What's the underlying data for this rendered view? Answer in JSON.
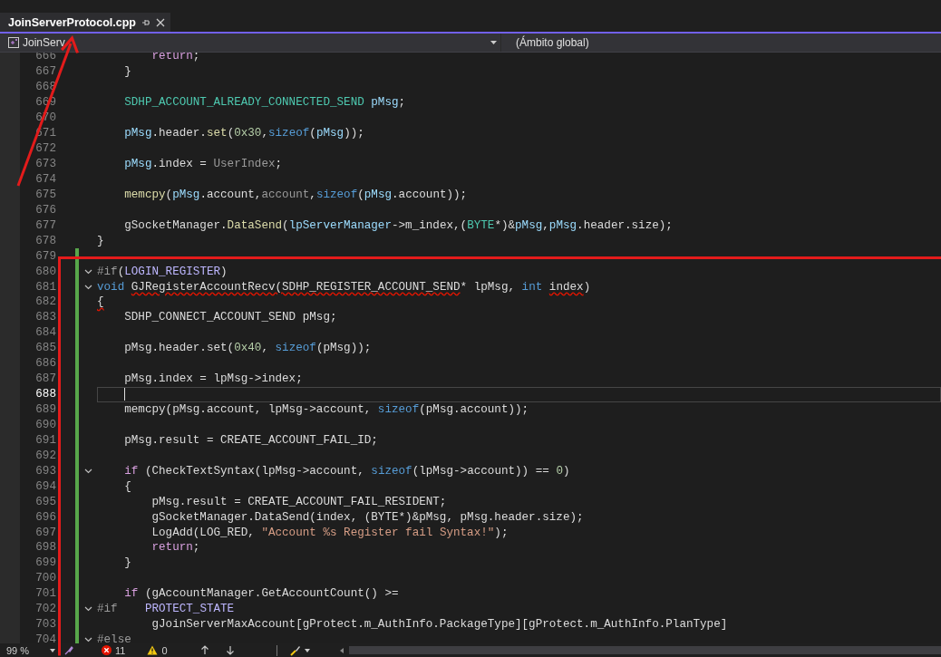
{
  "tabs": [
    {
      "label": "JoinServerProtocol.cpp",
      "selected": true
    }
  ],
  "navigation": {
    "project": "JoinServ",
    "scope": "(Ámbito global)"
  },
  "editor": {
    "lines": [
      {
        "number": "666",
        "changed": false,
        "collapsible": false,
        "current": false,
        "tokens": [
          {
            "kind": "ctl",
            "text": "        return"
          },
          {
            "kind": "plain",
            "text": ";"
          }
        ]
      },
      {
        "number": "667",
        "changed": false,
        "collapsible": false,
        "current": false,
        "tokens": [
          {
            "kind": "plain",
            "text": "    }"
          }
        ]
      },
      {
        "number": "668",
        "changed": false,
        "collapsible": false,
        "current": false
      },
      {
        "number": "669",
        "changed": false,
        "collapsible": false,
        "current": false,
        "tokens": [
          {
            "kind": "type",
            "text": "    SDHP_ACCOUNT_ALREADY_CONNECTED_SEND"
          },
          {
            "kind": "var",
            "text": " pMsg"
          },
          {
            "kind": "plain",
            "text": ";"
          }
        ]
      },
      {
        "number": "670",
        "changed": false,
        "collapsible": false,
        "current": false
      },
      {
        "number": "671",
        "changed": false,
        "collapsible": false,
        "current": false,
        "tokens": [
          {
            "kind": "var",
            "text": "    pMsg"
          },
          {
            "kind": "plain",
            "text": ".header."
          },
          {
            "kind": "fn",
            "text": "set"
          },
          {
            "kind": "plain",
            "text": "("
          },
          {
            "kind": "num",
            "text": "0x30"
          },
          {
            "kind": "plain",
            "text": ","
          },
          {
            "kind": "kw",
            "text": "sizeof"
          },
          {
            "kind": "plain",
            "text": "("
          },
          {
            "kind": "var",
            "text": "pMsg"
          },
          {
            "kind": "plain",
            "text": "));"
          }
        ]
      },
      {
        "number": "672",
        "changed": false,
        "collapsible": false,
        "current": false
      },
      {
        "number": "673",
        "changed": false,
        "collapsible": false,
        "current": false,
        "tokens": [
          {
            "kind": "var",
            "text": "    pMsg"
          },
          {
            "kind": "plain",
            "text": ".index = "
          },
          {
            "kind": "param",
            "text": "UserIndex"
          },
          {
            "kind": "plain",
            "text": ";"
          }
        ]
      },
      {
        "number": "674",
        "changed": false,
        "collapsible": false,
        "current": false
      },
      {
        "number": "675",
        "changed": false,
        "collapsible": false,
        "current": false,
        "tokens": [
          {
            "kind": "fn",
            "text": "    memcpy"
          },
          {
            "kind": "plain",
            "text": "("
          },
          {
            "kind": "var",
            "text": "pMsg"
          },
          {
            "kind": "plain",
            "text": ".account,"
          },
          {
            "kind": "param",
            "text": "account"
          },
          {
            "kind": "plain",
            "text": ","
          },
          {
            "kind": "kw",
            "text": "sizeof"
          },
          {
            "kind": "plain",
            "text": "("
          },
          {
            "kind": "var",
            "text": "pMsg"
          },
          {
            "kind": "plain",
            "text": ".account));"
          }
        ]
      },
      {
        "number": "676",
        "changed": false,
        "collapsible": false,
        "current": false
      },
      {
        "number": "677",
        "changed": false,
        "collapsible": false,
        "current": false,
        "tokens": [
          {
            "kind": "plain",
            "text": "    gSocketManager."
          },
          {
            "kind": "fn",
            "text": "DataSend"
          },
          {
            "kind": "plain",
            "text": "("
          },
          {
            "kind": "var",
            "text": "lpServerManager"
          },
          {
            "kind": "plain",
            "text": "->m_index,("
          },
          {
            "kind": "type",
            "text": "BYTE"
          },
          {
            "kind": "plain",
            "text": "*)&"
          },
          {
            "kind": "var",
            "text": "pMsg"
          },
          {
            "kind": "plain",
            "text": ","
          },
          {
            "kind": "var",
            "text": "pMsg"
          },
          {
            "kind": "plain",
            "text": ".header.size);"
          }
        ]
      },
      {
        "number": "678",
        "changed": false,
        "collapsible": false,
        "current": false,
        "tokens": [
          {
            "kind": "plain",
            "text": "}"
          }
        ]
      },
      {
        "number": "679",
        "changed": true,
        "collapsible": false,
        "current": false
      },
      {
        "number": "680",
        "changed": true,
        "collapsible": true,
        "current": false,
        "tokens": [
          {
            "kind": "pre",
            "text": "#if"
          },
          {
            "kind": "plain",
            "text": "("
          },
          {
            "kind": "macro",
            "text": "LOGIN_REGISTER"
          },
          {
            "kind": "plain",
            "text": ")"
          }
        ]
      },
      {
        "number": "681",
        "changed": true,
        "collapsible": true,
        "current": false,
        "tokens": [
          {
            "kind": "kw",
            "text": "void "
          },
          {
            "kind": "error",
            "text": "GJRegisterAccountRecv(SDHP_REGISTER_ACCOUNT_SEND"
          },
          {
            "kind": "plain",
            "text": "* lpMsg, "
          },
          {
            "kind": "kw",
            "text": "int "
          },
          {
            "kind": "error",
            "text": "index"
          },
          {
            "kind": "plain",
            "text": ")"
          }
        ]
      },
      {
        "number": "682",
        "changed": true,
        "collapsible": false,
        "current": false,
        "tokens": [
          {
            "kind": "error",
            "text": "{"
          }
        ]
      },
      {
        "number": "683",
        "changed": true,
        "collapsible": false,
        "current": false,
        "tokens": [
          {
            "kind": "plain",
            "text": "    SDHP_CONNECT_ACCOUNT_SEND pMsg;"
          }
        ]
      },
      {
        "number": "684",
        "changed": true,
        "collapsible": false,
        "current": false
      },
      {
        "number": "685",
        "changed": true,
        "collapsible": false,
        "current": false,
        "tokens": [
          {
            "kind": "plain",
            "text": "    pMsg.header.set("
          },
          {
            "kind": "num",
            "text": "0x40"
          },
          {
            "kind": "plain",
            "text": ", "
          },
          {
            "kind": "kw",
            "text": "sizeof"
          },
          {
            "kind": "plain",
            "text": "(pMsg));"
          }
        ]
      },
      {
        "number": "686",
        "changed": true,
        "collapsible": false,
        "current": false
      },
      {
        "number": "687",
        "changed": true,
        "collapsible": false,
        "current": false,
        "tokens": [
          {
            "kind": "plain",
            "text": "    pMsg.index = lpMsg->index;"
          }
        ]
      },
      {
        "number": "688",
        "changed": true,
        "collapsible": false,
        "current": true
      },
      {
        "number": "689",
        "changed": true,
        "collapsible": false,
        "current": false,
        "tokens": [
          {
            "kind": "plain",
            "text": "    memcpy(pMsg.account, lpMsg->account, "
          },
          {
            "kind": "kw",
            "text": "sizeof"
          },
          {
            "kind": "plain",
            "text": "(pMsg.account));"
          }
        ]
      },
      {
        "number": "690",
        "changed": true,
        "collapsible": false,
        "current": false
      },
      {
        "number": "691",
        "changed": true,
        "collapsible": false,
        "current": false,
        "tokens": [
          {
            "kind": "plain",
            "text": "    pMsg.result = CREATE_ACCOUNT_FAIL_ID;"
          }
        ]
      },
      {
        "number": "692",
        "changed": true,
        "collapsible": false,
        "current": false
      },
      {
        "number": "693",
        "changed": true,
        "collapsible": true,
        "current": false,
        "tokens": [
          {
            "kind": "ctl",
            "text": "    if"
          },
          {
            "kind": "plain",
            "text": " (CheckTextSyntax(lpMsg->account, "
          },
          {
            "kind": "kw",
            "text": "sizeof"
          },
          {
            "kind": "plain",
            "text": "(lpMsg->account)) == "
          },
          {
            "kind": "num",
            "text": "0"
          },
          {
            "kind": "plain",
            "text": ")"
          }
        ]
      },
      {
        "number": "694",
        "changed": true,
        "collapsible": false,
        "current": false,
        "tokens": [
          {
            "kind": "plain",
            "text": "    {"
          }
        ]
      },
      {
        "number": "695",
        "changed": true,
        "collapsible": false,
        "current": false,
        "tokens": [
          {
            "kind": "plain",
            "text": "        pMsg.result = CREATE_ACCOUNT_FAIL_RESIDENT;"
          }
        ]
      },
      {
        "number": "696",
        "changed": true,
        "collapsible": false,
        "current": false,
        "tokens": [
          {
            "kind": "plain",
            "text": "        gSocketManager.DataSend(index, (BYTE*)&pMsg, pMsg.header.size);"
          }
        ]
      },
      {
        "number": "697",
        "changed": true,
        "collapsible": false,
        "current": false,
        "tokens": [
          {
            "kind": "plain",
            "text": "        LogAdd(LOG_RED, "
          },
          {
            "kind": "str",
            "text": "\"Account %s Register fail Syntax!\""
          },
          {
            "kind": "plain",
            "text": ");"
          }
        ]
      },
      {
        "number": "698",
        "changed": true,
        "collapsible": false,
        "current": false,
        "tokens": [
          {
            "kind": "ctl",
            "text": "        return"
          },
          {
            "kind": "plain",
            "text": ";"
          }
        ]
      },
      {
        "number": "699",
        "changed": true,
        "collapsible": false,
        "current": false,
        "tokens": [
          {
            "kind": "plain",
            "text": "    }"
          }
        ]
      },
      {
        "number": "700",
        "changed": true,
        "collapsible": false,
        "current": false
      },
      {
        "number": "701",
        "changed": true,
        "collapsible": false,
        "current": false,
        "tokens": [
          {
            "kind": "ctl",
            "text": "    if"
          },
          {
            "kind": "plain",
            "text": " (gAccountManager.GetAccountCount() >="
          }
        ]
      },
      {
        "number": "702",
        "changed": true,
        "collapsible": true,
        "current": false,
        "tokens": [
          {
            "kind": "pre",
            "text": "#if"
          },
          {
            "kind": "macro",
            "text": "    PROTECT_STATE"
          }
        ]
      },
      {
        "number": "703",
        "changed": true,
        "collapsible": false,
        "current": false,
        "tokens": [
          {
            "kind": "plain",
            "text": "        gJoinServerMaxAccount[gProtect.m_AuthInfo.PackageType][gProtect.m_AuthInfo.PlanType]"
          }
        ]
      },
      {
        "number": "704",
        "changed": true,
        "collapsible": true,
        "current": false,
        "tokens": [
          {
            "kind": "pre",
            "text": "#else"
          }
        ]
      }
    ]
  },
  "status_bar": {
    "zoom": "99 %",
    "errors": "11",
    "warnings": "0"
  },
  "annotations": {
    "arrow": true,
    "highlight_box": true
  }
}
